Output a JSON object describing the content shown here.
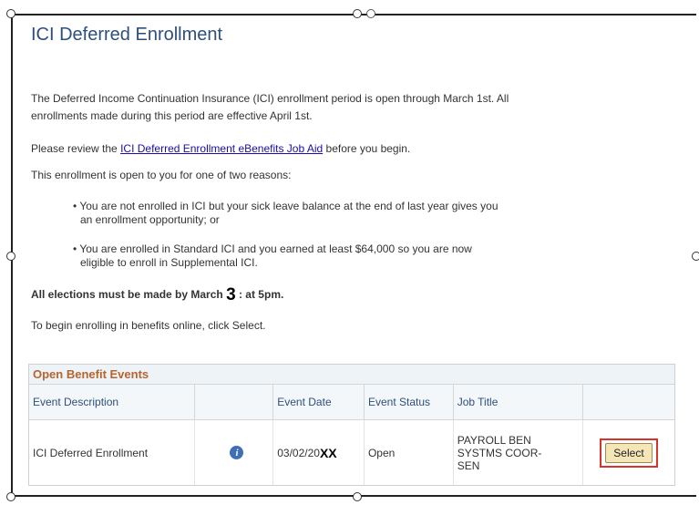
{
  "page": {
    "title": "ICI Deferred Enrollment",
    "intro_line1": "The Deferred Income Continuation Insurance (ICI) enrollment period is open through March 1st. All",
    "intro_line2": "enrollments made during this period are effective April 1st.",
    "review_prefix": "Please review the ",
    "review_link": "ICI Deferred Enrollment eBenefits Job Aid",
    "review_suffix": " before you begin.",
    "reasons_intro": "This enrollment is open to you for one of two reasons:",
    "bullet1_line1": "• You are not enrolled in ICI but your sick leave balance at the end of last year gives you",
    "bullet1_line2": "an enrollment opportunity; or",
    "bullet2_line1": "• You are enrolled in Standard ICI and you earned at least $64,000 so you are now",
    "bullet2_line2": "eligible to enroll in Supplemental ICI.",
    "deadline_prefix": "All elections must be made by March ",
    "deadline_day": "3",
    "deadline_suffix": " : at 5pm.",
    "begin_text": "To begin enrolling in benefits online, click Select."
  },
  "grid": {
    "caption": "Open Benefit Events",
    "headers": {
      "event_description": "Event Description",
      "info": "",
      "event_date": "Event Date",
      "event_status": "Event Status",
      "job_title": "Job Title",
      "action": ""
    },
    "rows": [
      {
        "event_description": "ICI Deferred Enrollment",
        "info_icon": "info-icon",
        "event_date_prefix": "03/02/20",
        "event_date_suffix": "XX",
        "event_status": "Open",
        "job_title_line1": "PAYROLL BEN",
        "job_title_line2": "SYSTMS COOR-",
        "job_title_line3": "SEN",
        "select_label": "Select"
      }
    ]
  },
  "colors": {
    "title": "#2d4f7c",
    "caption": "#b8642e",
    "link": "#1a0dab",
    "highlight_box": "#d9342b"
  }
}
